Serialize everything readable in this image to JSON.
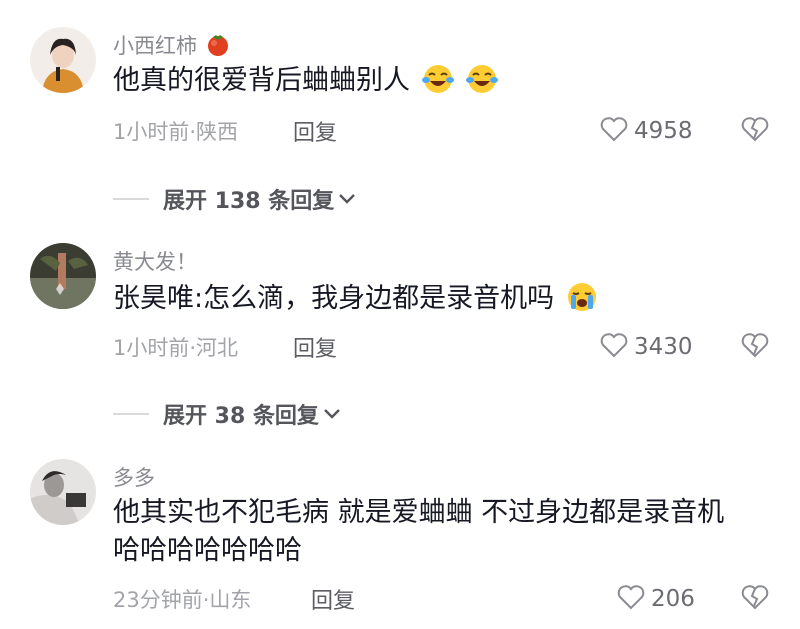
{
  "comments": [
    {
      "username": "小西红柿",
      "username_icon": "tomato-icon",
      "text": "他真的很爱背后蛐蛐别人",
      "emojis": [
        "crying-laugh-emoji",
        "crying-laugh-emoji"
      ],
      "meta": "1小时前·陕西",
      "reply_label": "回复",
      "likes": "4958",
      "expand_label": "展开 138 条回复"
    },
    {
      "username": "黄大发！",
      "text": "张昊唯:怎么滴，我身边都是录音机吗",
      "emojis": [
        "sobbing-emoji"
      ],
      "meta": "1小时前·河北",
      "reply_label": "回复",
      "likes": "3430",
      "expand_label": "展开 38 条回复"
    },
    {
      "username": "多多",
      "text_line1": "他其实也不犯毛病 就是爱蛐蛐 不过身边都是录音机",
      "text_line2": "哈哈哈哈哈哈哈",
      "meta": "23分钟前·山东",
      "reply_label": "回复",
      "likes": "206"
    }
  ],
  "colors": {
    "text": "#161823",
    "secondary": "#8a8b91",
    "accent_tomato": "#e0401f",
    "emoji_yellow": "#ffcc33"
  }
}
